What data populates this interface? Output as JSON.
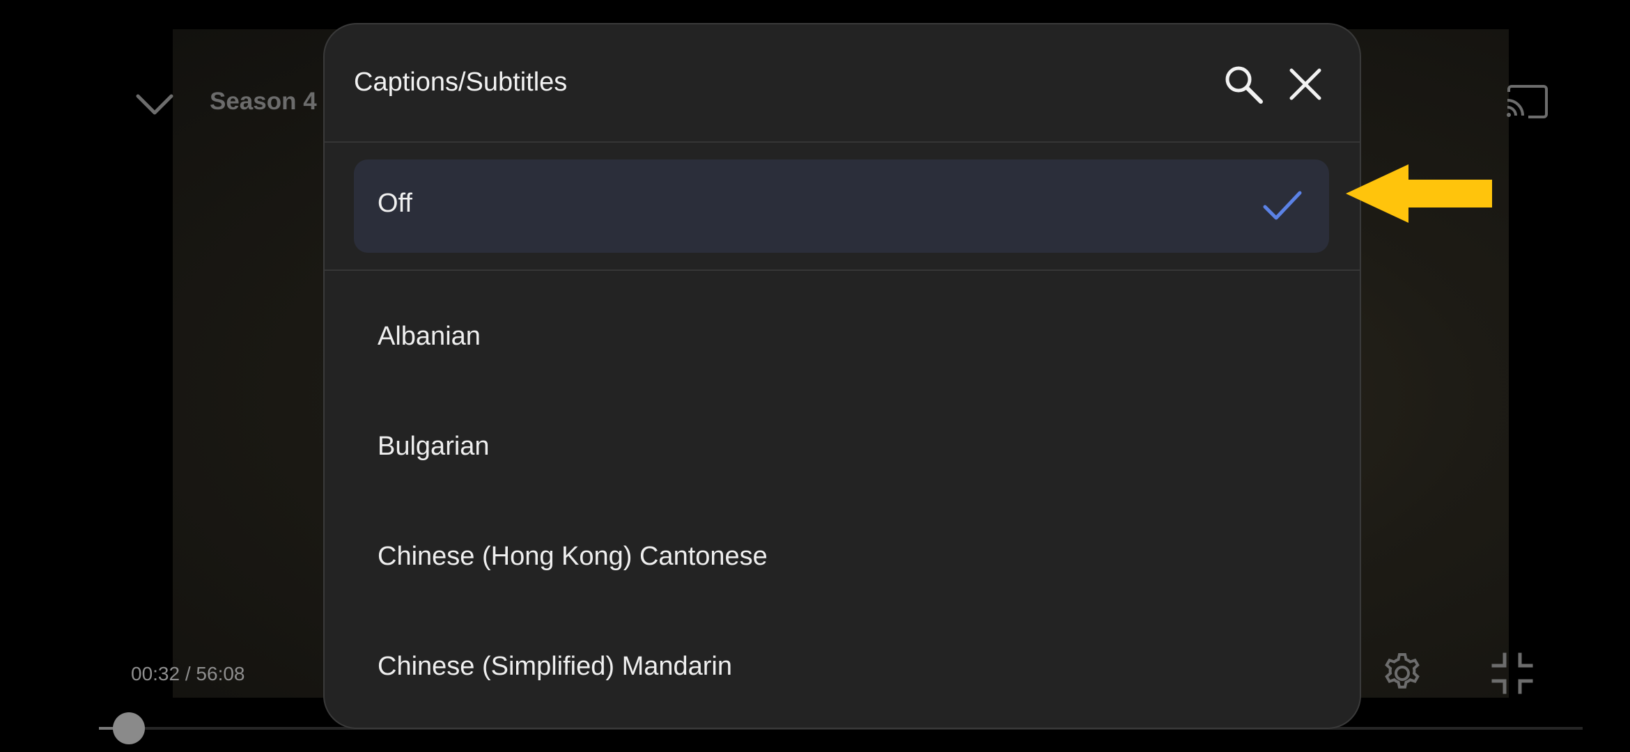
{
  "player": {
    "title": "Season 4",
    "time_current": "00:32",
    "time_separator": " / ",
    "time_total": "56:08",
    "progress_fraction": 0.01
  },
  "dialog": {
    "title": "Captions/Subtitles",
    "selected_option": "Off",
    "options": [
      "Albanian",
      "Bulgarian",
      "Chinese (Hong Kong) Cantonese",
      "Chinese (Simplified) Mandarin"
    ]
  },
  "icons": {
    "back": "chevron-down-icon",
    "cast": "cast-icon",
    "search": "search-icon",
    "close": "close-icon",
    "check": "checkmark-icon",
    "settings": "gear-icon",
    "exit_fullscreen": "exit-fullscreen-icon",
    "annotation": "arrow-left-icon"
  },
  "colors": {
    "accent_check": "#5b82e6",
    "annotation_arrow": "#ffc40c",
    "modal_bg": "#232323",
    "selected_bg": "#2b2e3a"
  }
}
